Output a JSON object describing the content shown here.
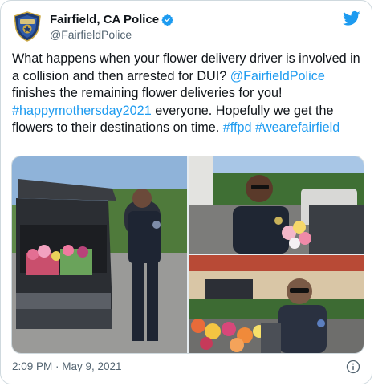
{
  "tweet": {
    "author": {
      "display_name": "Fairfield, CA Police",
      "handle": "@FairfieldPolice",
      "verified_icon": "verified-badge-icon",
      "avatar_icon": "police-badge-avatar"
    },
    "text_parts": {
      "p1": "What happens when your flower delivery driver is involved in a collision and then arrested for DUI? ",
      "mention": "@FairfieldPolice",
      "p2": " finishes the remaining flower deliveries for you! ",
      "hashtag1": "#happymothersday2021",
      "p3": " everyone. Hopefully we get the flowers to their destinations on time. ",
      "hashtag2": "#ffpd",
      "hashtag3": "#wearefairfield"
    },
    "media": [
      {
        "name": "photo-officer-at-car-trunk",
        "description_icon": "photo"
      },
      {
        "name": "photo-officer-with-flowers-smiling",
        "description_icon": "photo"
      },
      {
        "name": "photo-officer-in-car-with-flowers",
        "description_icon": "photo"
      }
    ],
    "timestamp": "2:09 PM · May 9, 2021",
    "colors": {
      "link": "#1d9bf0",
      "text": "#0f1419",
      "muted": "#536471",
      "border": "#cfd9de"
    },
    "icons": {
      "brand": "twitter-bird-icon",
      "info": "info-icon"
    }
  }
}
